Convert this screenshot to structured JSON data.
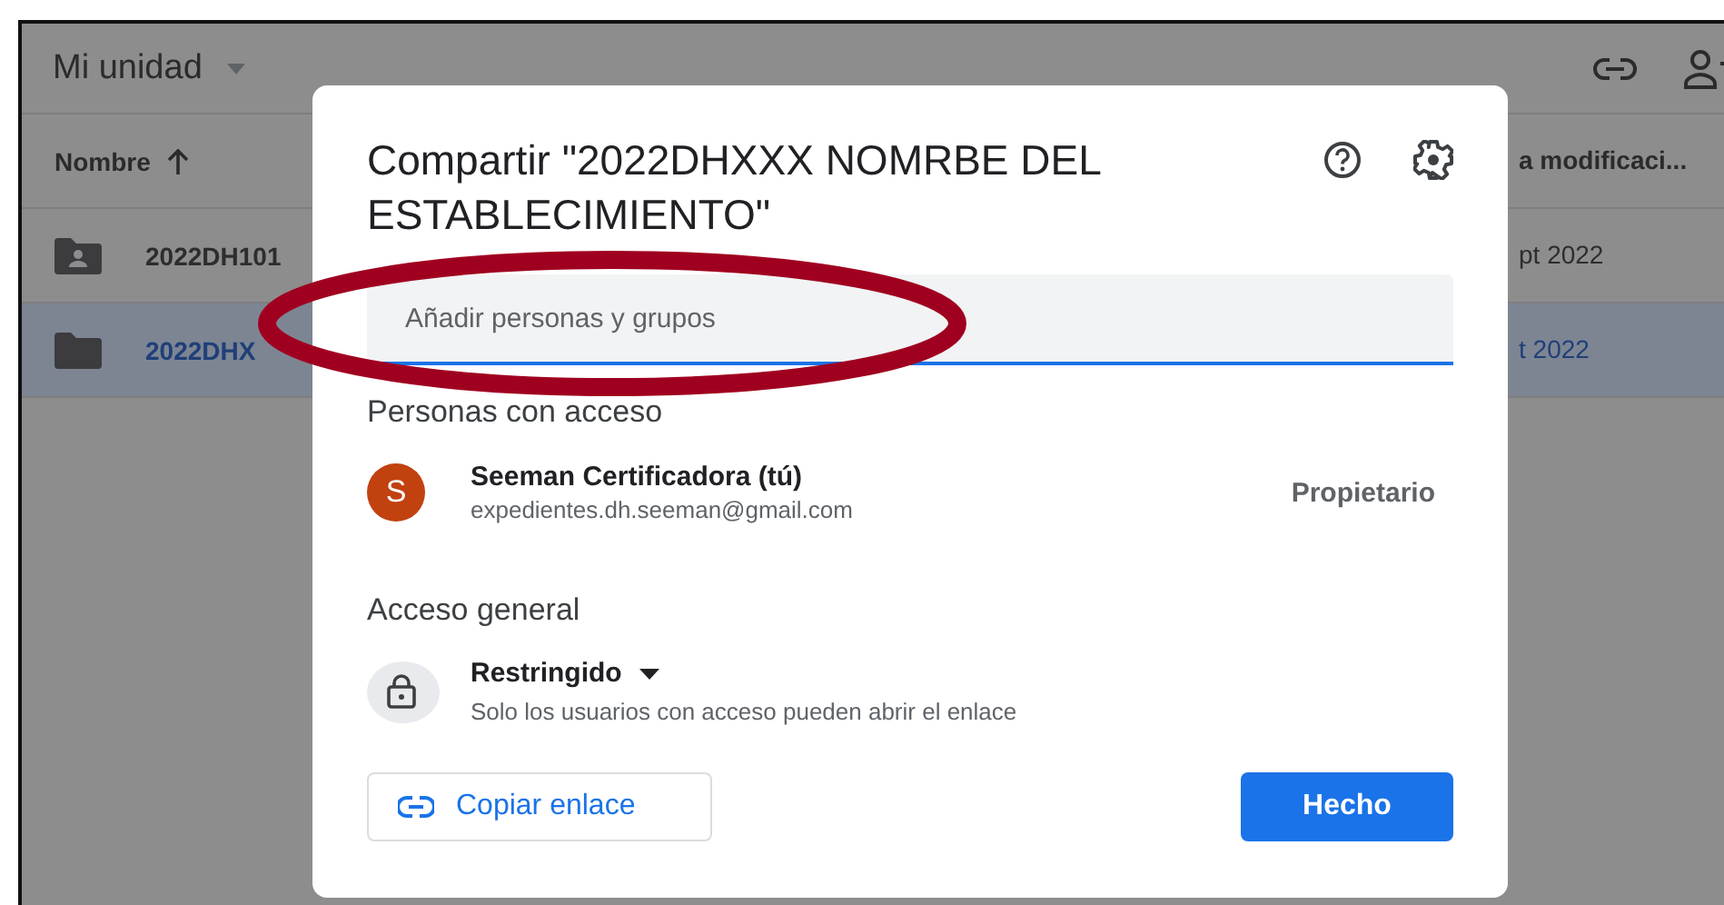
{
  "drive": {
    "title": "Mi unidad",
    "columns": [
      {
        "label": "Nombre",
        "sort_ascending": true
      },
      {
        "label": "a modificaci..."
      }
    ],
    "rows": [
      {
        "kind": "shared_folder",
        "name": "2022DH101",
        "date": "pt 2022",
        "selected": false
      },
      {
        "kind": "folder",
        "name": "2022DHX",
        "date": "t 2022",
        "selected": true
      }
    ]
  },
  "dialog": {
    "title": "Compartir \"2022DHXXX NOMRBE DEL ESTABLECIMIENTO\"",
    "field": {
      "placeholder": "Añadir personas y grupos"
    },
    "people_heading": "Personas con acceso",
    "people": [
      {
        "initial": "S",
        "name": "Seeman Certificadora (tú)",
        "email": "expedientes.dh.seeman@gmail.com",
        "role": "Propietario"
      }
    ],
    "general_heading": "Acceso general",
    "general_access": {
      "kind": "restricted",
      "label": "Restringido",
      "description": "Solo los usuarios con acceso pueden abrir el enlace"
    },
    "buttons": [
      {
        "kind": "copy_link",
        "label": "Copiar enlace"
      },
      {
        "kind": "done",
        "label": "Hecho"
      }
    ]
  },
  "annotation": {
    "kind": "ellipse"
  }
}
